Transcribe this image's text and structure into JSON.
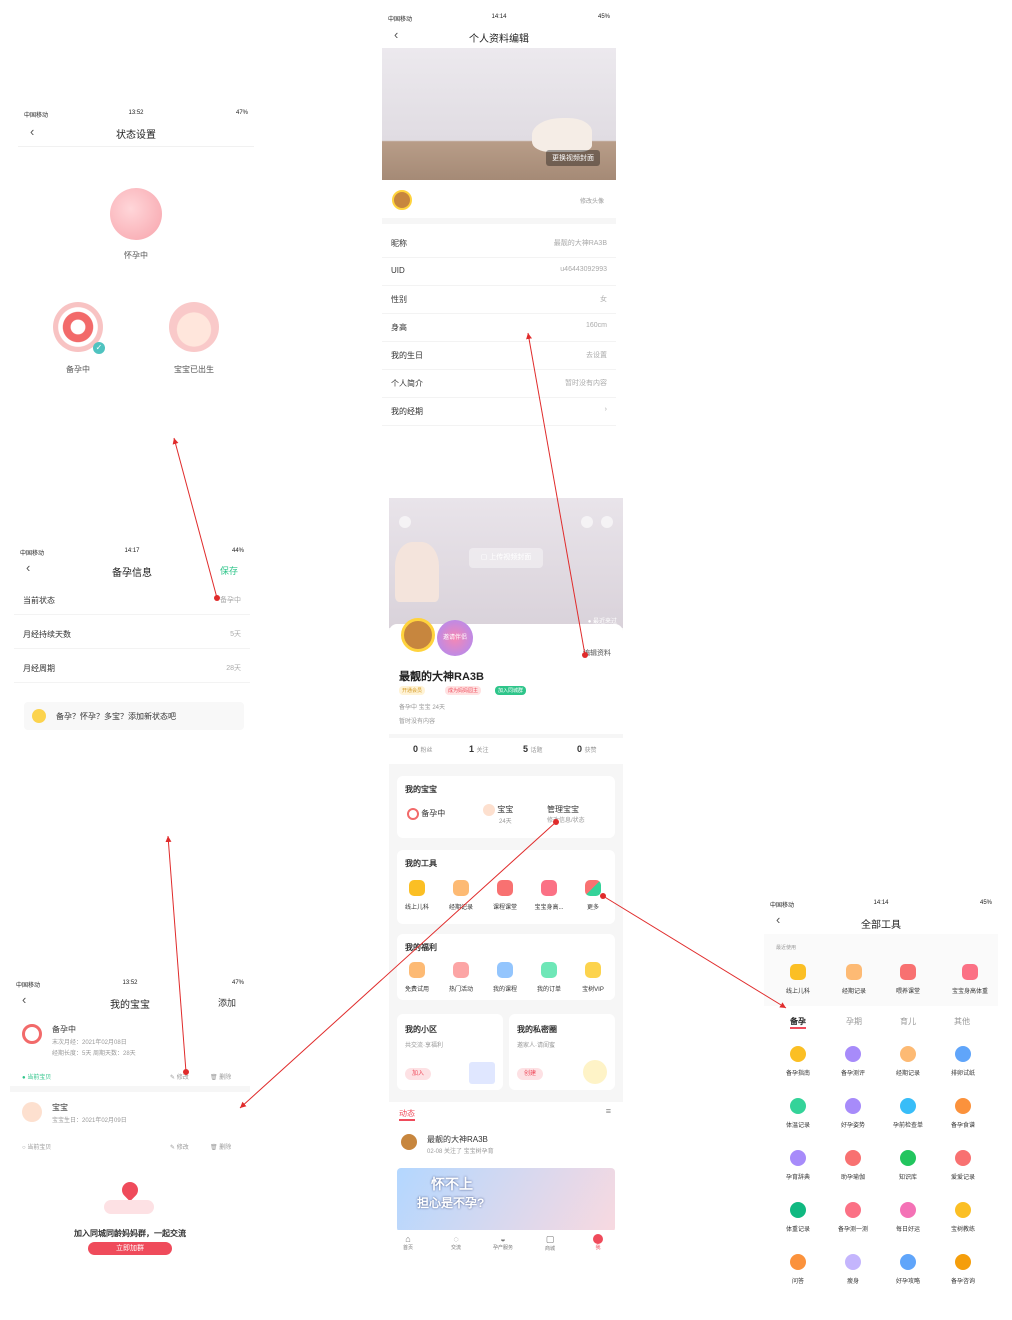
{
  "colors": {
    "accent": "#ef4b5b",
    "green": "#2ec58a",
    "orange": "#f9a93b",
    "purple": "#8b7cf6",
    "blue": "#4e9ef5",
    "gray_bg": "#f6f6f6"
  },
  "screen_status": {
    "title": "状态设置",
    "carrier": "中国移动",
    "time": "13:52",
    "battery": "47%",
    "options": [
      {
        "label": "怀孕中"
      },
      {
        "label": "备孕中"
      },
      {
        "label": "宝宝已出生"
      }
    ]
  },
  "screen_prep": {
    "title": "备孕信息",
    "carrier": "中国移动",
    "time": "14:17",
    "battery": "44%",
    "save": "保存",
    "rows": [
      {
        "label": "当前状态",
        "value": "备孕中"
      },
      {
        "label": "月经持续天数",
        "value": "5天"
      },
      {
        "label": "月经周期",
        "value": "28天"
      }
    ],
    "add_prompt": "备孕？怀孕？多宝？添加新状态吧"
  },
  "screen_baby": {
    "title": "我的宝宝",
    "carrier": "中国移动",
    "time": "13:52",
    "battery": "47%",
    "add": "添加",
    "items": [
      {
        "name": "备孕中",
        "line1": "末次月经：2021年02月08日",
        "line2": "经期长度：5天  周期天数：28天",
        "current": "当前宝贝",
        "edit": "修改",
        "delete": "删除"
      },
      {
        "name": "宝宝",
        "line1": "宝宝生日：2021年02月09日",
        "current": "当前宝贝",
        "edit": "修改",
        "delete": "删除"
      }
    ],
    "promo": "加入同城同龄妈妈群，一起交流",
    "promo_button": "立即加群"
  },
  "screen_profile": {
    "title": "个人资料编辑",
    "carrier": "中国移动",
    "time": "14:14",
    "battery": "45%",
    "cover_button": "更换视频封面",
    "avatar_action": "修改头像",
    "rows": [
      {
        "label": "昵称",
        "value": "最靓的大神RA3B"
      },
      {
        "label": "UID",
        "value": "u46443092993"
      },
      {
        "label": "性别",
        "value": "女"
      },
      {
        "label": "身高",
        "value": "160cm"
      },
      {
        "label": "我的生日",
        "value": "去设置"
      },
      {
        "label": "个人简介",
        "value": "暂时没有内容"
      },
      {
        "label": "我的经期",
        "value": ""
      }
    ]
  },
  "screen_me": {
    "upload": "上传视频封面",
    "recent": "最近来过",
    "edit": "编辑资料",
    "invite": "邀请伴侣",
    "name": "最靓的大神RA3B",
    "badges": [
      "开通会员",
      "成为妈妈园主",
      "加入同城群"
    ],
    "status_line": "备孕中  宝宝 24天",
    "bio": "暂时没有内容",
    "stats": [
      {
        "n": "0",
        "l": "粉丝"
      },
      {
        "n": "1",
        "l": "关注"
      },
      {
        "n": "5",
        "l": "话题"
      },
      {
        "n": "0",
        "l": "获赞"
      }
    ],
    "baby_title": "我的宝宝",
    "baby_items": [
      {
        "label": "备孕中"
      },
      {
        "label": "宝宝",
        "sub": "24天"
      },
      {
        "label": "管理宝宝",
        "sub": "修改信息/状态"
      }
    ],
    "tools_title": "我的工具",
    "tools": [
      "线上儿科",
      "经期记录",
      "课程课堂",
      "宝宝身高...",
      "更多"
    ],
    "welfare_title": "我的福利",
    "welfare": [
      "免费试用",
      "热门活动",
      "我的课程",
      "我的订单",
      "宝树VIP"
    ],
    "community": {
      "title": "我的小区",
      "sub": "共交流·享福利",
      "btn": "加入"
    },
    "private": {
      "title": "我的私密圈",
      "sub": "邀家人·请闺蜜",
      "btn": "创建"
    },
    "feed_tab": "动态",
    "feed_user": "最靓的大神RA3B",
    "feed_meta": "02-08 关注了 宝宝树孕育",
    "banner_text1": "怀不上",
    "banner_text2": "担心是不孕?",
    "tabbar": [
      "首页",
      "交流",
      "孕产服务",
      "商城",
      "我"
    ]
  },
  "screen_tools": {
    "title": "全部工具",
    "carrier": "中国移动",
    "time": "14:14",
    "battery": "45%",
    "recent_label": "最近使用",
    "recent": [
      "线上儿科",
      "经期记录",
      "喂养课堂",
      "宝宝身高体重"
    ],
    "tabs": [
      "备孕",
      "孕期",
      "育儿",
      "其他"
    ],
    "grid": [
      "备孕指南",
      "备孕测评",
      "经期记录",
      "排卵试纸",
      "体温记录",
      "好孕姿势",
      "孕前检查单",
      "备孕食谱",
      "孕育辞典",
      "助孕瑜伽",
      "知识库",
      "爱爱记录",
      "体重记录",
      "备孕测一测",
      "每日好运",
      "宝树教练",
      "问答",
      "瘦身",
      "好孕攻略",
      "备孕咨询"
    ]
  }
}
